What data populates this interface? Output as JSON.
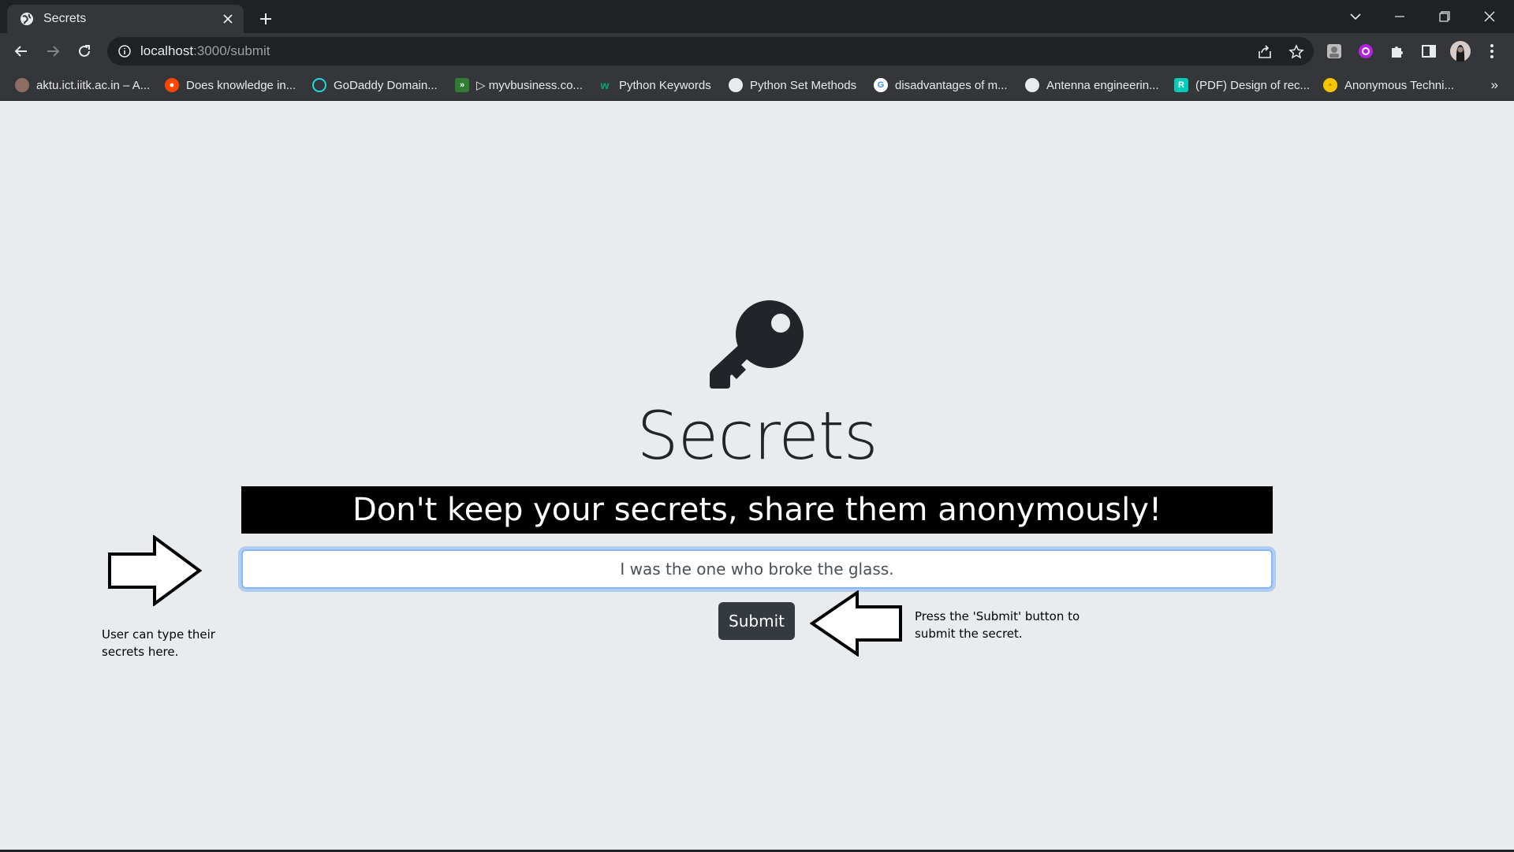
{
  "browser": {
    "tab": {
      "title": "Secrets",
      "favicon": "globe-icon"
    },
    "address": {
      "host": "localhost",
      "path": ":3000/submit"
    },
    "bookmarks": [
      {
        "label": "aktu.ict.iitk.ac.in – A...",
        "icon_color": "#8d6e63"
      },
      {
        "label": "Does knowledge in...",
        "icon_color": "#ff4500"
      },
      {
        "label": "GoDaddy Domain...",
        "icon_color": "#1bdbdb"
      },
      {
        "label": "▷ myvbusiness.co...",
        "icon_color": "#2e7d32"
      },
      {
        "label": "Python Keywords",
        "icon_color": "#00a86b"
      },
      {
        "label": "Python Set Methods",
        "icon_color": "#9aa0a6"
      },
      {
        "label": "disadvantages of m...",
        "icon_color": "#ffffff"
      },
      {
        "label": "Antenna engineerin...",
        "icon_color": "#9aa0a6"
      },
      {
        "label": "(PDF) Design of rec...",
        "icon_color": "#00ccbb"
      },
      {
        "label": "Anonymous Techni...",
        "icon_color": "#f9c400"
      }
    ],
    "bookmarks_more": "»"
  },
  "page": {
    "brand": "Secrets",
    "tagline": "Don't keep your secrets, share them anonymously!",
    "input_value": "I was the one who broke the glass.",
    "submit_label": "Submit",
    "note_left_line1": "User can type their",
    "note_left_line2": "secrets here.",
    "note_right_line1": "Press the 'Submit' button to",
    "note_right_line2": "submit the secret."
  }
}
